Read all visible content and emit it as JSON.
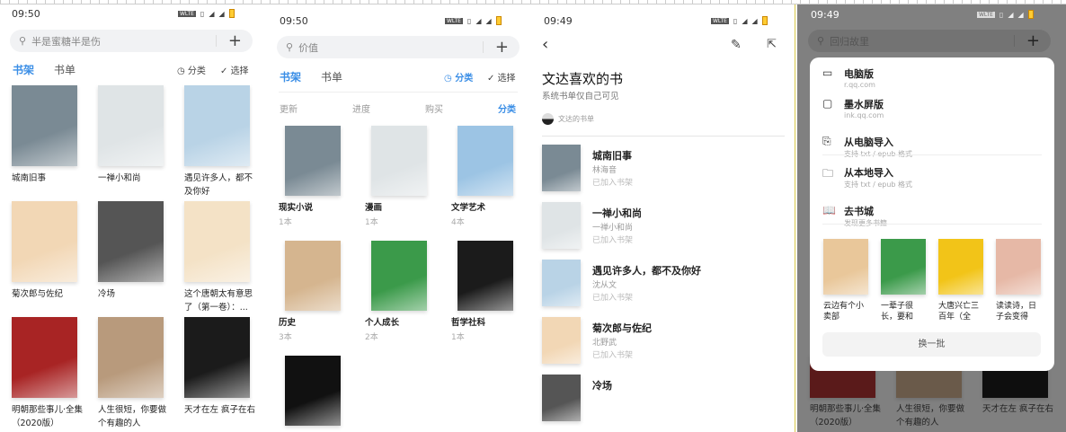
{
  "screens": [
    {
      "time": "09:50",
      "search_placeholder": "半是蜜糖半是伤",
      "tabs": [
        "书架",
        "书单"
      ],
      "actions": [
        "分类",
        "选择"
      ],
      "books": [
        {
          "title": "城南旧事",
          "color": "#7a8a94"
        },
        {
          "title": "一禅小和尚",
          "color": "#dfe4e6"
        },
        {
          "title": "遇见许多人，都不及你好",
          "color": "#b9d3e6"
        },
        {
          "title": "菊次郎与佐纪",
          "color": "#f2d7b5"
        },
        {
          "title": "冷场",
          "color": "#555555"
        },
        {
          "title": "这个唐朝太有意思了（第一卷）：...",
          "color": "#f4e2c6"
        },
        {
          "title": "明朝那些事儿·全集（2020版）",
          "color": "#a82424"
        },
        {
          "title": "人生很短，你要做个有趣的人",
          "color": "#b89a7c"
        },
        {
          "title": "天才在左 疯子在右",
          "color": "#1b1b1b"
        }
      ]
    },
    {
      "time": "09:50",
      "search_placeholder": "价值",
      "tabs": [
        "书架",
        "书单"
      ],
      "actions": [
        "分类",
        "选择"
      ],
      "subtabs": [
        "更新",
        "进度",
        "购买",
        "分类"
      ],
      "categories": [
        {
          "name": "现实小说",
          "count": "1本",
          "color": "#7a8a94"
        },
        {
          "name": "漫画",
          "count": "1本",
          "color": "#dfe4e6"
        },
        {
          "name": "文学艺术",
          "count": "4本",
          "color": "#9cc4e4"
        },
        {
          "name": "历史",
          "count": "3本",
          "color": "#d5b58f"
        },
        {
          "name": "个人成长",
          "count": "2本",
          "color": "#3b9a4a"
        },
        {
          "name": "哲学社科",
          "count": "1本",
          "color": "#1b1b1b"
        },
        {
          "name": "",
          "count": "",
          "color": "#111111"
        }
      ]
    },
    {
      "time": "09:49",
      "title": "文达喜欢的书",
      "subtitle": "系统书单仅自己可见",
      "owner": "文达的书单",
      "items": [
        {
          "title": "城南旧事",
          "author": "林海音",
          "status": "已加入书架",
          "color": "#7a8a94"
        },
        {
          "title": "一禅小和尚",
          "author": "一禅小和尚",
          "status": "已加入书架",
          "color": "#dfe4e6"
        },
        {
          "title": "遇见许多人，都不及你好",
          "author": "沈从文",
          "status": "已加入书架",
          "color": "#b9d3e6"
        },
        {
          "title": "菊次郎与佐纪",
          "author": "北野武",
          "status": "已加入书架",
          "color": "#f2d7b5"
        },
        {
          "title": "冷场",
          "author": "",
          "status": "",
          "color": "#555555"
        }
      ]
    },
    {
      "time": "09:49",
      "search_placeholder": "回归故里",
      "menu": [
        {
          "icon": "monitor-icon",
          "glyph": "▭",
          "title": "电脑版",
          "sub": "r.qq.com"
        },
        {
          "icon": "tablet-icon",
          "glyph": "▢",
          "title": "墨水屏版",
          "sub": "ink.qq.com"
        },
        {
          "icon": "import-icon",
          "glyph": "⎘",
          "title": "从电脑导入",
          "sub": "支持 txt / epub 格式"
        },
        {
          "icon": "folder-icon",
          "glyph": "🗀",
          "title": "从本地导入",
          "sub": "支持 txt / epub 格式"
        },
        {
          "icon": "book-icon",
          "glyph": "📖",
          "title": "去书城",
          "sub": "发现更多书籍"
        }
      ],
      "recommend": [
        {
          "title": "云边有个小卖部",
          "color": "#e9c79a"
        },
        {
          "title": "一辈子很长，要和有...",
          "color": "#3b9a4a"
        },
        {
          "title": "大唐兴亡三百年（全集...",
          "color": "#f2c418"
        },
        {
          "title": "读读诗，日子会变得潇...",
          "color": "#e6b8a6"
        }
      ],
      "refresh": "换一批",
      "bg_books": [
        "明朝那些事儿·全集（2020版）",
        "人生很短，你要做个有趣的人",
        "天才在左 疯子在右"
      ]
    }
  ],
  "accent": "#3a8ee6"
}
